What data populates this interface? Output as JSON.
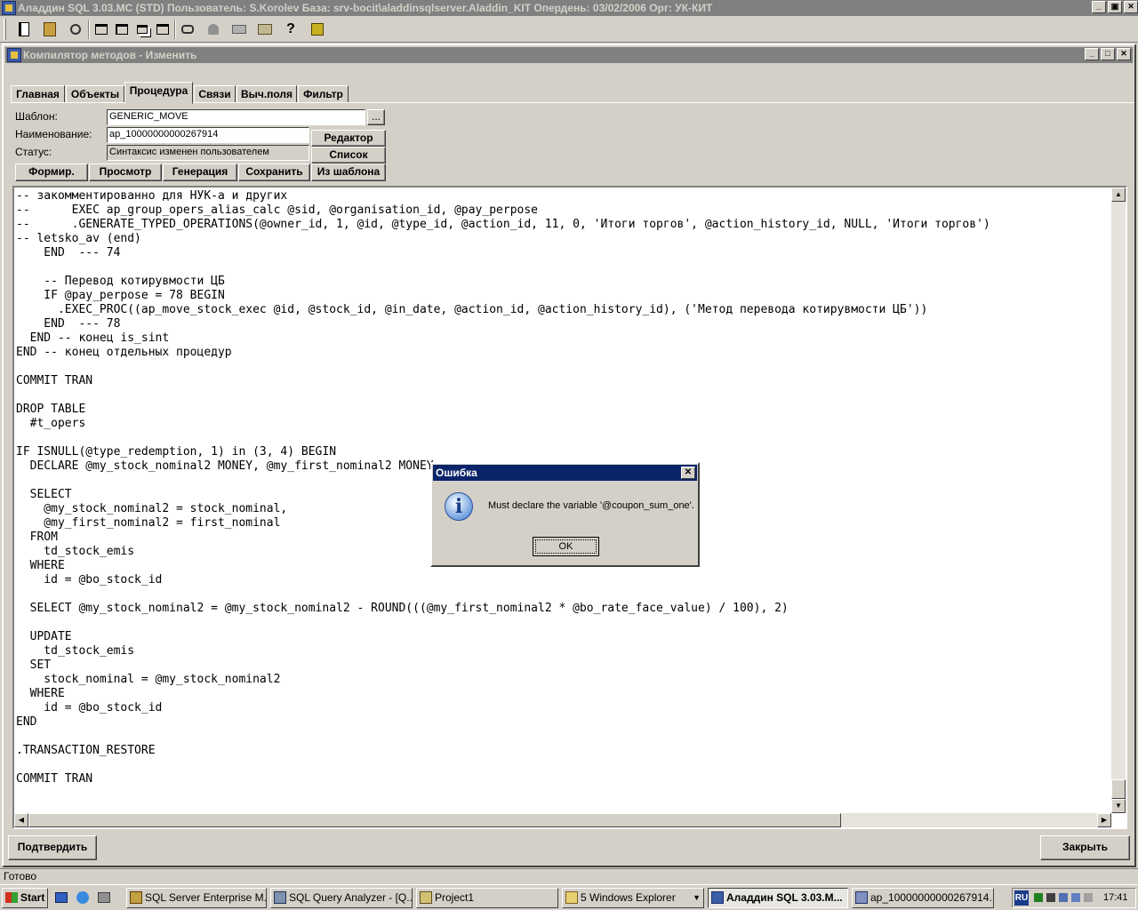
{
  "app": {
    "title": "Аладдин SQL 3.03.MC (STD)  Пользователь: S.Korolev База: srv-bocit\\aladdinsqlserver.Aladdin_KIT Опердень: 03/02/2006 Орг: УК-КИТ",
    "window_buttons": [
      "_",
      "▣",
      "✕"
    ]
  },
  "toolbar": {
    "icons": [
      "notebook-icon",
      "cabinet-icon",
      "search-person-icon",
      "window-icon",
      "tile-icon",
      "cascade-icon",
      "arrange-icon",
      "binoculars-icon",
      "stamp-icon",
      "print-icon",
      "folder-icon",
      "help-icon",
      "exit-icon"
    ]
  },
  "child": {
    "title": "Компилятор методов - Изменить",
    "window_buttons": [
      "_",
      "□",
      "✕"
    ]
  },
  "tabs": [
    "Главная",
    "Объекты",
    "Процедура",
    "Связи",
    "Выч.поля",
    "Фильтр"
  ],
  "active_tab": "Процедура",
  "form": {
    "template_label": "Шаблон:",
    "template_value": "GENERIC_MOVE",
    "browse_label": "...",
    "name_label": "Наименование:",
    "name_value": "ap_10000000000267914",
    "status_label": "Статус:",
    "status_value": "Синтаксис изменен пользователем",
    "editor_button": "Редактор",
    "list_button": "Список",
    "actions": [
      "Формир.",
      "Просмотр",
      "Генерация",
      "Сохранить",
      "Из шаблона"
    ]
  },
  "code": "-- закомментированно для НУК-а и других\n--      EXEC ap_group_opers_alias_calc @sid, @organisation_id, @pay_perpose\n--      .GENERATE_TYPED_OPERATIONS(@owner_id, 1, @id, @type_id, @action_id, 11, 0, 'Итоги торгов', @action_history_id, NULL, 'Итоги торгов')\n-- letsko_av (end)\n    END  --- 74\n\n    -- Перевод котирувмости ЦБ\n    IF @pay_perpose = 78 BEGIN\n      .EXEC_PROC((ap_move_stock_exec @id, @stock_id, @in_date, @action_id, @action_history_id), ('Метод перевода котирувмости ЦБ'))\n    END  --- 78\n  END -- конец is_sint\nEND -- конец отдельных процедур\n\nCOMMIT TRAN\n\nDROP TABLE\n  #t_opers\n\nIF ISNULL(@type_redemption, 1) in (3, 4) BEGIN\n  DECLARE @my_stock_nominal2 MONEY, @my_first_nominal2 MONEY\n\n  SELECT\n    @my_stock_nominal2 = stock_nominal,\n    @my_first_nominal2 = first_nominal\n  FROM\n    td_stock_emis\n  WHERE\n    id = @bo_stock_id\n\n  SELECT @my_stock_nominal2 = @my_stock_nominal2 - ROUND(((@my_first_nominal2 * @bo_rate_face_value) / 100), 2)\n\n  UPDATE\n    td_stock_emis\n  SET\n    stock_nominal = @my_stock_nominal2\n  WHERE\n    id = @bo_stock_id\nEND\n\n.TRANSACTION_RESTORE\n\nCOMMIT TRAN",
  "bottom": {
    "confirm_button": "Подтвердить",
    "close_button": "Закрыть"
  },
  "status_bar": "Готово",
  "dialog": {
    "title": "Ошибка",
    "message": "Must declare the variable '@coupon_sum_one'.",
    "ok_label": "OK",
    "close_glyph": "✕"
  },
  "taskbar": {
    "start_label": "Start",
    "tasks": [
      {
        "label": "SQL Server Enterprise M...",
        "active": false
      },
      {
        "label": "SQL Query Analyzer - [Q...",
        "active": false
      },
      {
        "label": "Project1",
        "active": false
      },
      {
        "label": "5 Windows Explorer",
        "active": false
      },
      {
        "label": "Аладдин SQL 3.03.M...",
        "active": true
      },
      {
        "label": "ap_10000000000267914...",
        "active": false
      }
    ],
    "tray_lang": "RU",
    "clock": "17:41"
  },
  "colors": {
    "face": "#d4d0c8",
    "inactive_title": "#808080",
    "active_title": "#0a246a"
  }
}
